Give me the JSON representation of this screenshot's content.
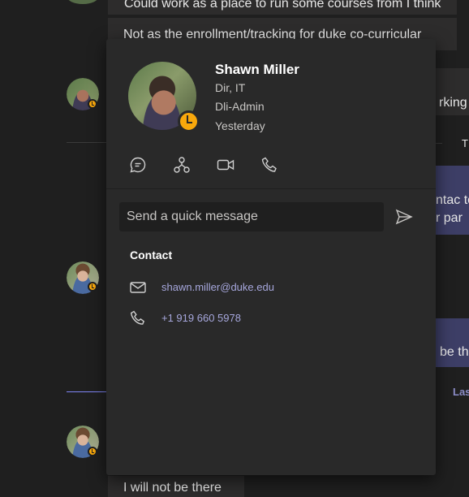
{
  "chat": {
    "msg_top": "Could work as a place to run some courses from I think",
    "msg_tracking": "Not as the enrollment/tracking for duke co-curricular",
    "frag_working": "rking",
    "frag_t": "T",
    "frag_ntac": "ntac to",
    "frag_rpar": "r par",
    "frag_be_the": "be th",
    "frag_last": "Las",
    "msg_bottom": "I will not be there"
  },
  "card": {
    "name": "Shawn Miller",
    "title": "Dir, IT",
    "department": "Dli-Admin",
    "last_seen": "Yesterday",
    "status": "away",
    "actions": [
      {
        "name": "chat",
        "icon": "chat-bubble-icon"
      },
      {
        "name": "org-chart",
        "icon": "org-chart-icon"
      },
      {
        "name": "video-call",
        "icon": "video-camera-icon"
      },
      {
        "name": "audio-call",
        "icon": "phone-icon"
      }
    ],
    "quick_message_placeholder": "Send a quick message",
    "contact_heading": "Contact",
    "email": "shawn.miller@duke.edu",
    "phone": "+1 919 660 5978"
  },
  "colors": {
    "accent": "#a6a7dc",
    "status_away": "#f8a80c",
    "card_bg": "#292929",
    "page_bg": "#1f1f1f",
    "bubble_self": "#3d3e66"
  }
}
